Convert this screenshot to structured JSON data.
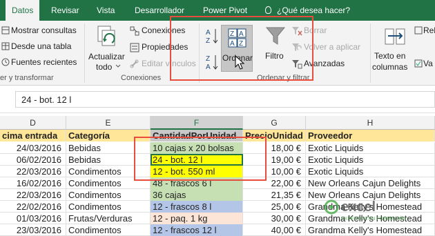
{
  "colors": {
    "brand": "#217346",
    "highlight_red": "#e74c3c",
    "yellow": "#ffff00",
    "orange": "#ffe699",
    "green": "#c6e0b4",
    "blue": "#b4c6e7",
    "orange_light": "#fce4d6"
  },
  "tabs": [
    {
      "label": "Datos"
    },
    {
      "label": "Revisar"
    },
    {
      "label": "Vista"
    },
    {
      "label": "Desarrollador"
    },
    {
      "label": "Power Pivot"
    }
  ],
  "tellme": "¿Qué desea hacer?",
  "ribbon": {
    "get_transform": {
      "show_queries": "Mostrar consultas",
      "from_table": "Desde una tabla",
      "recent_sources": "Fuentes recientes",
      "group_label": "er y transformar"
    },
    "connections": {
      "refresh_line1": "Actualizar",
      "refresh_line2": "todo",
      "connections": "Conexiones",
      "properties": "Propiedades",
      "edit_links": "Editar vínculos",
      "group_label": "Conexiones"
    },
    "sort_filter": {
      "sort": "Ordenar",
      "filter": "Filtro",
      "clear": "Borrar",
      "reapply": "Volver a aplicar",
      "advanced": "Avanzadas",
      "group_label": "Ordenar y filtrar"
    },
    "data_tools": {
      "text_cols_line1": "Texto en",
      "text_cols_line2": "columnas",
      "partial": "Rel",
      "partial2": "Va"
    }
  },
  "formula_bar": {
    "value": "24 - bot. 12 l"
  },
  "columns": [
    "D",
    "E",
    "F",
    "G",
    "H"
  ],
  "headers": [
    "cima entrada",
    "Categoría",
    "CantidadPorUnidad",
    "PrecioUnidad",
    "Proveedor"
  ],
  "rows": [
    {
      "d": "24/03/2016",
      "e": "Bebidas",
      "f": "10 cajas x 20 bolsas",
      "g": "18,00 €",
      "h": "Exotic Liquids",
      "fill": "green"
    },
    {
      "d": "06/02/2016",
      "e": "Bebidas",
      "f": "24 - bot. 12 l",
      "g": "19,00 €",
      "h": "Exotic Liquids",
      "fill": "yellow"
    },
    {
      "d": "22/03/2016",
      "e": "Condimentos",
      "f": "12 - bot. 550 ml",
      "g": "10,00 €",
      "h": "Exotic Liquids",
      "fill": "yellow"
    },
    {
      "d": "16/02/2016",
      "e": "Condimentos",
      "f": "48 - frascos 6 l",
      "g": "22,00 €",
      "h": "New Orleans Cajun Delights",
      "fill": "green"
    },
    {
      "d": "22/03/2016",
      "e": "Condimentos",
      "f": "36 cajas",
      "g": "21,35 €",
      "h": "New Orleans Cajun Delights",
      "fill": "green"
    },
    {
      "d": "22/02/2016",
      "e": "Condimentos",
      "f": "12 - frascos 8 l",
      "g": "25,00 €",
      "h": "Grandma Kelly's Homestead",
      "fill": "blue"
    },
    {
      "d": "01/03/2016",
      "e": "Frutas/Verduras",
      "f": "12 - paq. 1 kg",
      "g": "30,00 €",
      "h": "Grandma Kelly's Homestead",
      "fill": "orange"
    },
    {
      "d": "23/03/2016",
      "e": "Condimentos",
      "f": "12 - frascos 12 l",
      "g": "40,00 €",
      "h": "Grandma Kelly's Homestead",
      "fill": "blue"
    }
  ],
  "watermark": {
    "brand": "excel",
    "sub": "EXPERTOS EN FORMACIÓN"
  }
}
